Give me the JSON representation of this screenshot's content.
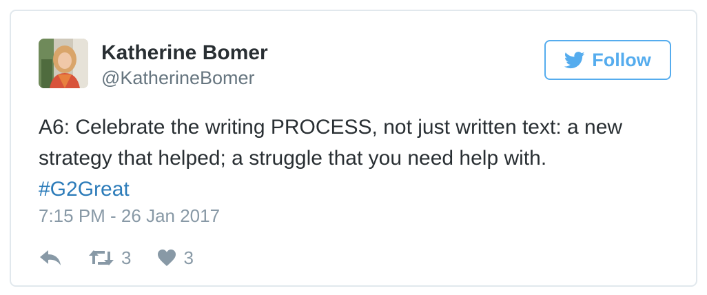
{
  "user": {
    "name": "Katherine Bomer",
    "handle": "@KatherineBomer"
  },
  "follow_button": {
    "label": "Follow",
    "icon": "twitter-bird-icon"
  },
  "tweet": {
    "text_line_1": "A6: Celebrate the writing PROCESS, not just written text: a new",
    "text_line_2": "strategy that helped; a struggle that you need help with.",
    "hashtag": "#G2Great",
    "timestamp": "7:15 PM - 26 Jan 2017"
  },
  "actions": {
    "reply_icon": "reply-icon",
    "retweet_icon": "retweet-icon",
    "retweet_count": "3",
    "like_icon": "heart-icon",
    "like_count": "3"
  },
  "colors": {
    "accent": "#55acee",
    "hashtag": "#2b7bb9",
    "text": "#292f33",
    "muted": "#8899a6",
    "border": "#e1e8ed"
  }
}
